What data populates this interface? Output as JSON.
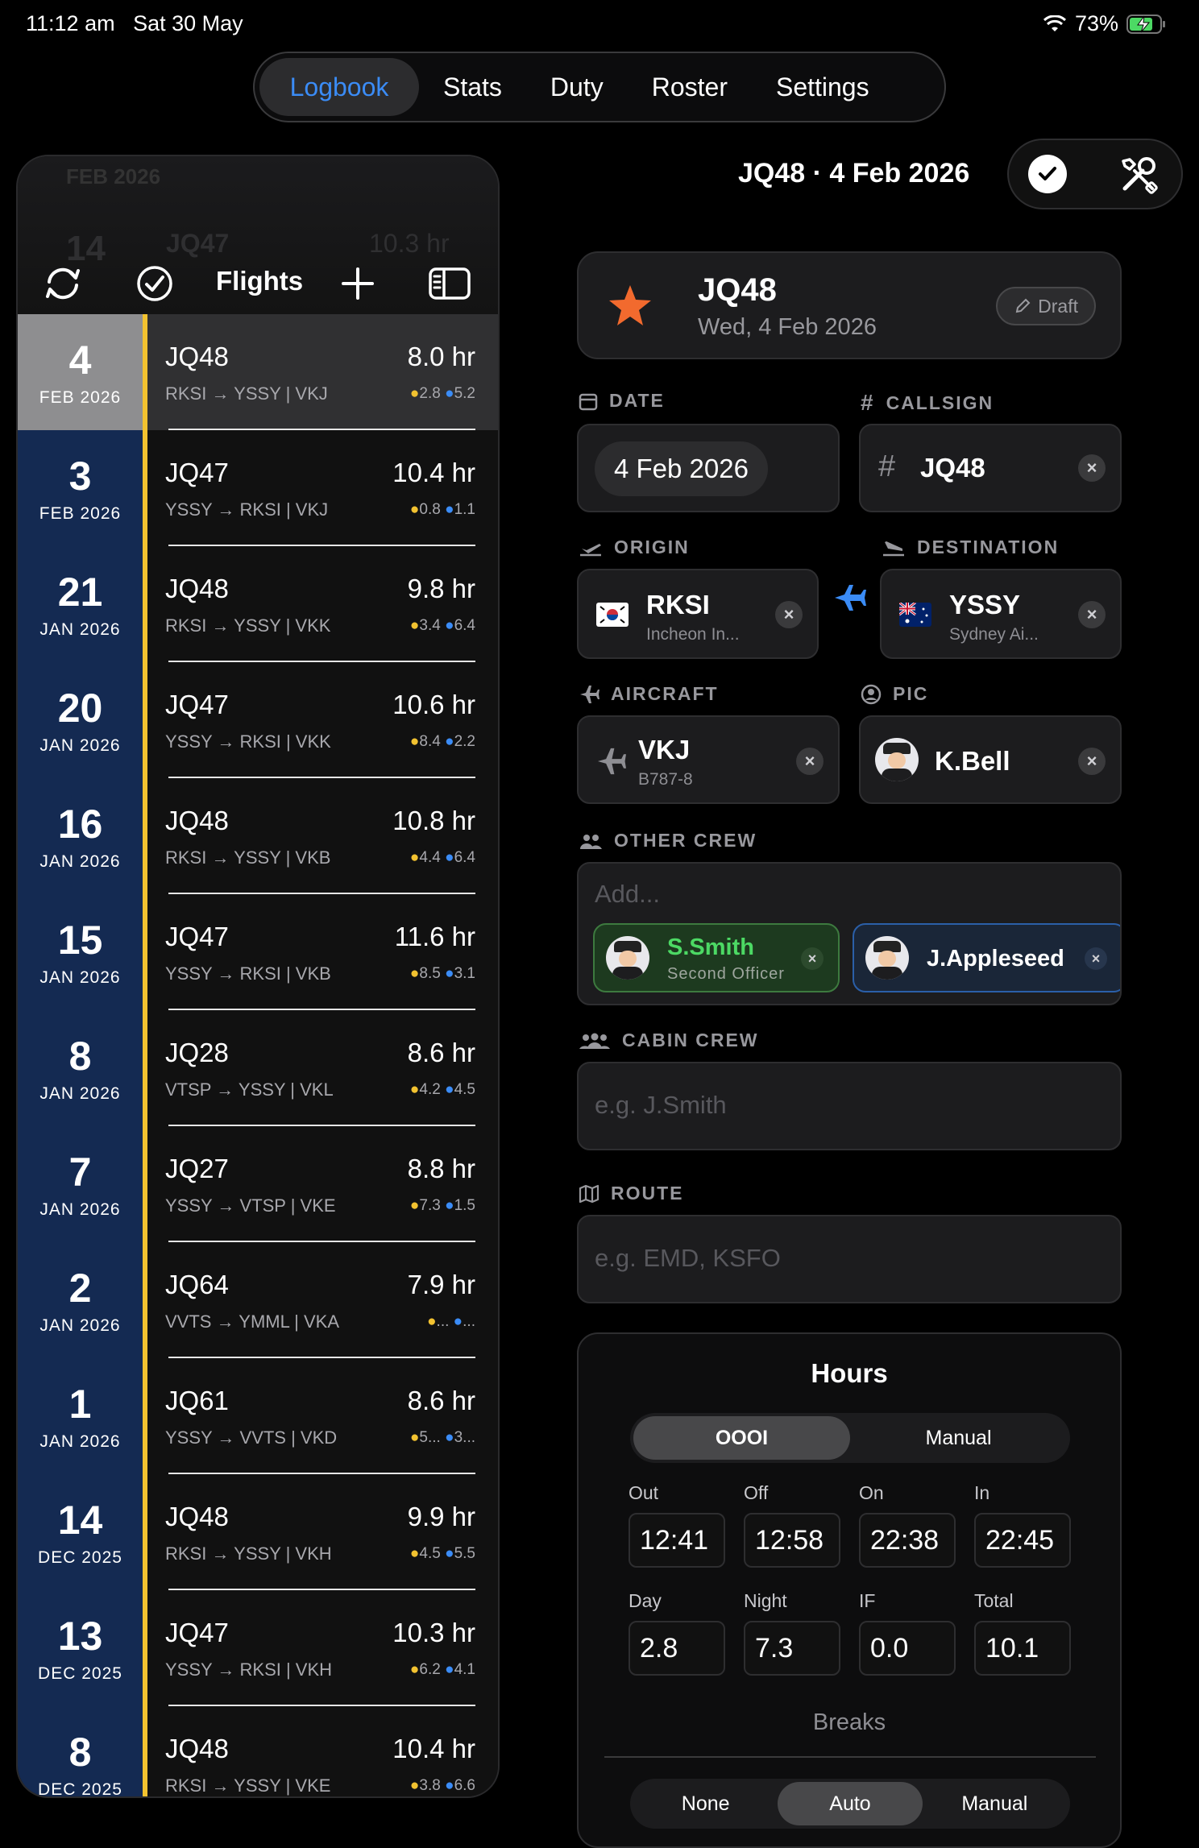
{
  "status_bar": {
    "time": "11:12 am",
    "date": "Sat 30 May",
    "battery": "73%"
  },
  "top_tabs": [
    {
      "label": "Logbook",
      "active": true
    },
    {
      "label": "Stats",
      "active": false
    },
    {
      "label": "Duty",
      "active": false
    },
    {
      "label": "Roster",
      "active": false
    },
    {
      "label": "Settings",
      "active": false
    }
  ],
  "sidebar": {
    "title": "Flights",
    "faded_row": {
      "month": "FEB 2026",
      "day": "14",
      "flight": "JQ47",
      "hours": "10.3 hr"
    },
    "flights": [
      {
        "day": "4",
        "month": "FEB 2026",
        "flight": "JQ48",
        "hours": "8.0 hr",
        "route": "RKSI → YSSY  |  VKJ",
        "day_time": "2.8",
        "night_time": "5.2",
        "selected": true
      },
      {
        "day": "3",
        "month": "FEB 2026",
        "flight": "JQ47",
        "hours": "10.4 hr",
        "route": "YSSY → RKSI  |  VKJ",
        "day_time": "0.8",
        "night_time": "1.1"
      },
      {
        "day": "21",
        "month": "JAN 2026",
        "flight": "JQ48",
        "hours": "9.8 hr",
        "route": "RKSI → YSSY  |  VKK",
        "day_time": "3.4",
        "night_time": "6.4"
      },
      {
        "day": "20",
        "month": "JAN 2026",
        "flight": "JQ47",
        "hours": "10.6 hr",
        "route": "YSSY → RKSI  |  VKK",
        "day_time": "8.4",
        "night_time": "2.2"
      },
      {
        "day": "16",
        "month": "JAN 2026",
        "flight": "JQ48",
        "hours": "10.8 hr",
        "route": "RKSI → YSSY  |  VKB",
        "day_time": "4.4",
        "night_time": "6.4"
      },
      {
        "day": "15",
        "month": "JAN 2026",
        "flight": "JQ47",
        "hours": "11.6 hr",
        "route": "YSSY → RKSI  |  VKB",
        "day_time": "8.5",
        "night_time": "3.1"
      },
      {
        "day": "8",
        "month": "JAN 2026",
        "flight": "JQ28",
        "hours": "8.6 hr",
        "route": "VTSP → YSSY  |  VKL",
        "day_time": "4.2",
        "night_time": "4.5"
      },
      {
        "day": "7",
        "month": "JAN 2026",
        "flight": "JQ27",
        "hours": "8.8 hr",
        "route": "YSSY → VTSP  |  VKE",
        "day_time": "7.3",
        "night_time": "1.5"
      },
      {
        "day": "2",
        "month": "JAN 2026",
        "flight": "JQ64",
        "hours": "7.9 hr",
        "route": "VVTS → YMML  |  VKA",
        "day_time": "...",
        "night_time": "..."
      },
      {
        "day": "1",
        "month": "JAN 2026",
        "flight": "JQ61",
        "hours": "8.6 hr",
        "route": "YSSY → VVTS  |  VKD",
        "day_time": "5...",
        "night_time": "3..."
      },
      {
        "day": "14",
        "month": "DEC 2025",
        "flight": "JQ48",
        "hours": "9.9 hr",
        "route": "RKSI → YSSY  |  VKH",
        "day_time": "4.5",
        "night_time": "5.5"
      },
      {
        "day": "13",
        "month": "DEC 2025",
        "flight": "JQ47",
        "hours": "10.3 hr",
        "route": "YSSY → RKSI  |  VKH",
        "day_time": "6.2",
        "night_time": "4.1"
      },
      {
        "day": "8",
        "month": "DEC 2025",
        "flight": "JQ48",
        "hours": "10.4 hr",
        "route": "RKSI → YSSY  |  VKE",
        "day_time": "3.8",
        "night_time": "6.6"
      }
    ]
  },
  "detail": {
    "header_title": "JQ48 · 4 Feb 2026",
    "card": {
      "flight": "JQ48",
      "date": "Wed, 4 Feb 2026",
      "badge": "Draft"
    },
    "date": {
      "label": "DATE",
      "value": "4 Feb 2026"
    },
    "callsign": {
      "label": "CALLSIGN",
      "value": "JQ48"
    },
    "origin": {
      "label": "ORIGIN",
      "code": "RKSI",
      "name": "Incheon In..."
    },
    "destination": {
      "label": "DESTINATION",
      "code": "YSSY",
      "name": "Sydney Ai..."
    },
    "aircraft": {
      "label": "AIRCRAFT",
      "reg": "VKJ",
      "type": "B787-8"
    },
    "pic": {
      "label": "PIC",
      "name": "K.Bell"
    },
    "other_crew": {
      "label": "OTHER CREW",
      "placeholder": "Add...",
      "members": [
        {
          "name": "S.Smith",
          "role": "Second Officer"
        },
        {
          "name": "J.Appleseed"
        }
      ]
    },
    "cabin_crew": {
      "label": "CABIN CREW",
      "placeholder": "e.g. J.Smith"
    },
    "route": {
      "label": "ROUTE",
      "placeholder": "e.g. EMD, KSFO"
    },
    "hours": {
      "title": "Hours",
      "mode_options": [
        "OOOI",
        "Manual"
      ],
      "mode_selected": "OOOI",
      "times": [
        {
          "label": "Out",
          "value": "12:41"
        },
        {
          "label": "Off",
          "value": "12:58"
        },
        {
          "label": "On",
          "value": "22:38"
        },
        {
          "label": "In",
          "value": "22:45"
        }
      ],
      "totals": [
        {
          "label": "Day",
          "value": "2.8"
        },
        {
          "label": "Night",
          "value": "7.3"
        },
        {
          "label": "IF",
          "value": "0.0"
        },
        {
          "label": "Total",
          "value": "10.1"
        }
      ],
      "breaks_label": "Breaks",
      "breaks_options": [
        "None",
        "Auto",
        "Manual"
      ],
      "breaks_selected": "Auto"
    }
  },
  "colors": {
    "accent": "#3b8cf6",
    "highlight": "#f2c230",
    "date_column": "#142a52",
    "crew_green": "#4cd964",
    "star": "#f26a2e"
  }
}
